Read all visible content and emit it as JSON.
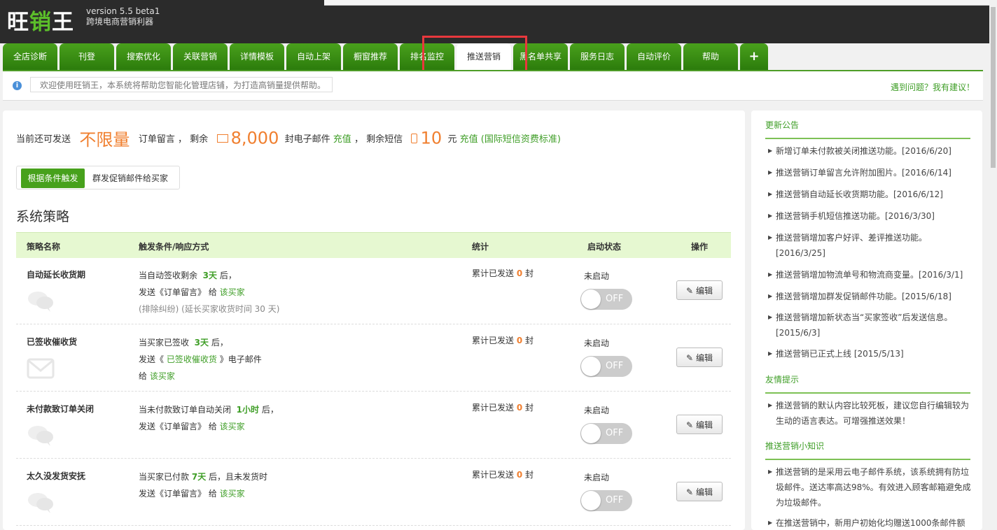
{
  "app": {
    "logo_a": "旺",
    "logo_b": "销",
    "logo_c": "王",
    "version": "version 5.5 beta1",
    "slogan": "跨境电商营销利器"
  },
  "tabs": [
    "全店诊断",
    "刊登",
    "搜索优化",
    "关联营销",
    "详情模板",
    "自动上架",
    "橱窗推荐",
    "排名监控",
    "推送营销",
    "黑名单共享",
    "服务日志",
    "自动评价",
    "帮助",
    "+"
  ],
  "active_tab": "推送营销",
  "notice": {
    "welcome": "欢迎使用旺销王，本系统将帮助您智能化管理店铺，为打造高销量提供帮助。",
    "feedback": "遇到问题？我有建议！"
  },
  "quota": {
    "lead": "当前还可发送",
    "unlimited": "不限量",
    "after_unlimited": "订单留言 ，  剩余",
    "email_count": "8,000",
    "email_unit": "封电子邮件",
    "recharge": "充值",
    "sms_lead": "，  剩余短信",
    "sms_count": "10",
    "sms_unit": "元",
    "sms_recharge": "充值",
    "sms_standard": "(国际短信资费标准)"
  },
  "subtabs": [
    "根据条件触发",
    "群发促销邮件给买家"
  ],
  "section_title": "系统策略",
  "table": {
    "headers": [
      "策略名称",
      "触发条件/响应方式",
      "统计",
      "启动状态",
      "操作"
    ],
    "rows": [
      {
        "name": "自动延长收货期",
        "icon": "chat-bubbles-icon",
        "c1a": "当自动签收剩余",
        "c1b": "3天",
        "c1c": "后，",
        "c2a": "发送《订单留言》 给",
        "c2b": "该买家",
        "c2c": "",
        "c3": "(排除纠纷) (延长买家收货时间 30 天)",
        "stat_a": "累计已发送",
        "stat_n": "0",
        "stat_b": "封",
        "state": "未启动",
        "toggle": "OFF",
        "edit": "编辑"
      },
      {
        "name": "已签收催收货",
        "icon": "envelope-icon",
        "c1a": "当买家已签收",
        "c1b": "3天",
        "c1c": "后，",
        "c2a": "发送《",
        "c2b": "已签收催收货",
        "c2c": "》电子邮件",
        "c3a": "给",
        "c3b": "该买家",
        "stat_a": "累计已发送",
        "stat_n": "0",
        "stat_b": "封",
        "state": "未启动",
        "toggle": "OFF",
        "edit": "编辑"
      },
      {
        "name": "未付款致订单关闭",
        "icon": "chat-bubbles-icon",
        "c1a": "当未付款致订单自动关闭",
        "c1b": "1小时",
        "c1c": "后，",
        "c2a": "发送《订单留言》 给",
        "c2b": "该买家",
        "c2c": "",
        "stat_a": "累计已发送",
        "stat_n": "0",
        "stat_b": "封",
        "state": "未启动",
        "toggle": "OFF",
        "edit": "编辑"
      },
      {
        "name": "太久没发货安抚",
        "icon": "chat-bubbles-icon",
        "c1a": "当买家已付款",
        "c1b": "7天",
        "c1c": "后，且未发货时",
        "c2a": "发送《订单留言》 给",
        "c2b": "该买家",
        "c2c": "",
        "stat_a": "累计已发送",
        "stat_n": "0",
        "stat_b": "封",
        "state": "未启动",
        "toggle": "OFF",
        "edit": "编辑"
      }
    ]
  },
  "sidebar": {
    "updates_title": "更新公告",
    "updates": [
      "新增订单未付款被关闭推送功能。[2016/6/20]",
      "推送营销订单留言允许附加图片。[2016/6/14]",
      "推送营销自动延长收货期功能。[2016/6/12]",
      "推送营销手机短信推送功能。[2016/3/30]",
      "推送营销增加客户好评、差评推送功能。[2016/3/25]",
      "推送营销增加物流单号和物流商变量。[2016/3/1]",
      "推送营销增加群发促销邮件功能。[2015/6/18]",
      "推送营销增加新状态当“买家签收”后发送信息。[2015/6/3]",
      "推送营销已正式上线 [2015/5/13]"
    ],
    "tips_title": "友情提示",
    "tips": [
      "推送营销的默认内容比较死板，建议您自行编辑较为生动的语言表达。可增强推送效果！"
    ],
    "knowledge_title": "推送营销小知识",
    "knowledge": [
      "推送营销的是采用云电子邮件系统，该系统拥有防垃圾邮件。送达率高达98%。有效进入顾客邮箱避免成为垃圾邮件。",
      "在推送营销中，新用户初始化均赠送1000条邮件额"
    ]
  }
}
